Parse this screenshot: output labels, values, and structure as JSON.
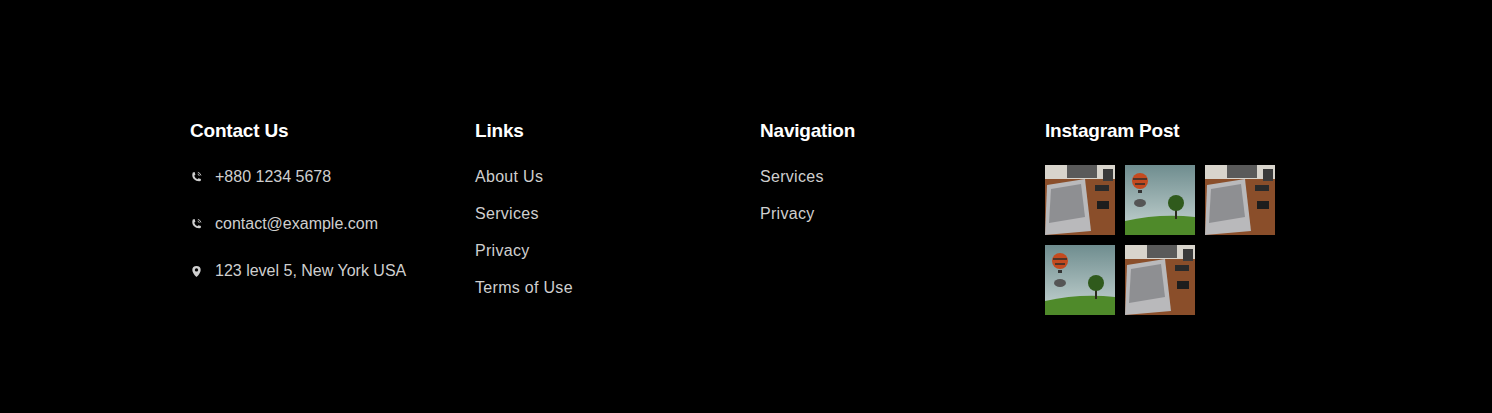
{
  "contact": {
    "title": "Contact Us",
    "items": [
      {
        "text": "+880 1234 5678",
        "kind": "phone"
      },
      {
        "text": "contact@example.com",
        "kind": "phone"
      },
      {
        "text": "123 level 5, New York USA",
        "kind": "location"
      }
    ]
  },
  "links": {
    "title": "Links",
    "items": [
      "About Us",
      "Services",
      "Privacy",
      "Terms of Use"
    ]
  },
  "navigation": {
    "title": "Navigation",
    "items": [
      "Services",
      "Privacy"
    ]
  },
  "instagram": {
    "title": "Instagram Post",
    "posts": [
      {
        "kind": "desk"
      },
      {
        "kind": "balloon"
      },
      {
        "kind": "desk"
      },
      {
        "kind": "balloon"
      },
      {
        "kind": "desk"
      }
    ]
  }
}
